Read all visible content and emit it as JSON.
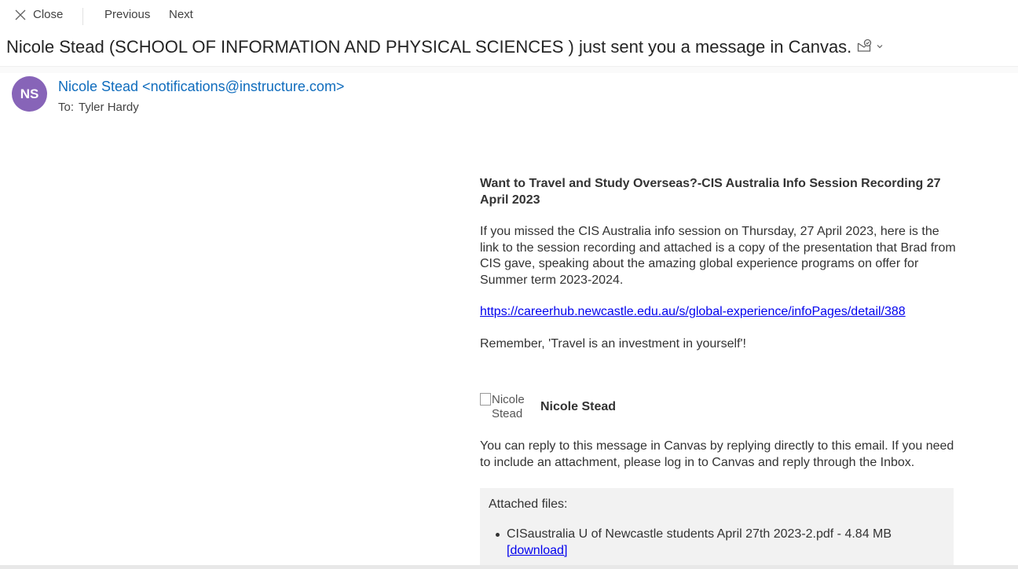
{
  "toolbar": {
    "close_label": "Close",
    "previous_label": "Previous",
    "next_label": "Next"
  },
  "subject": "Nicole Stead (SCHOOL OF INFORMATION AND PHYSICAL SCIENCES ) just sent you a message in Canvas.",
  "header": {
    "avatar_initials": "NS",
    "avatar_color": "#8764b8",
    "sender": "Nicole Stead <notifications@instructure.com>",
    "to_label": "To:",
    "to_name": "Tyler Hardy"
  },
  "message": {
    "title": "Want to Travel and Study Overseas?-CIS Australia Info Session Recording 27 April 2023",
    "paragraph1": "If you missed the CIS Australia info session on Thursday, 27 April 2023, here is the link to the session recording and attached is a copy of the presentation that Brad from CIS gave, speaking about the amazing global experience programs on offer for Summer term 2023-2024.",
    "link": "https://careerhub.newcastle.edu.au/s/global-experience/infoPages/detail/388",
    "paragraph2": "Remember, 'Travel is an investment in yourself'!"
  },
  "signature": {
    "image_alt": "Nicole Stead",
    "name": "Nicole Stead"
  },
  "reply_note": "You can reply to this message in Canvas by replying directly to this email. If you need to include an attachment, please log in to Canvas and reply through the Inbox.",
  "attachments": {
    "title": "Attached files:",
    "items": [
      {
        "name": "CISaustralia U of Newcastle students April 27th 2023-2.pdf - 4.84 MB",
        "download_label": "[download]"
      }
    ]
  },
  "colors": {
    "link": "#0000ee",
    "sender": "#0f6cbd"
  }
}
